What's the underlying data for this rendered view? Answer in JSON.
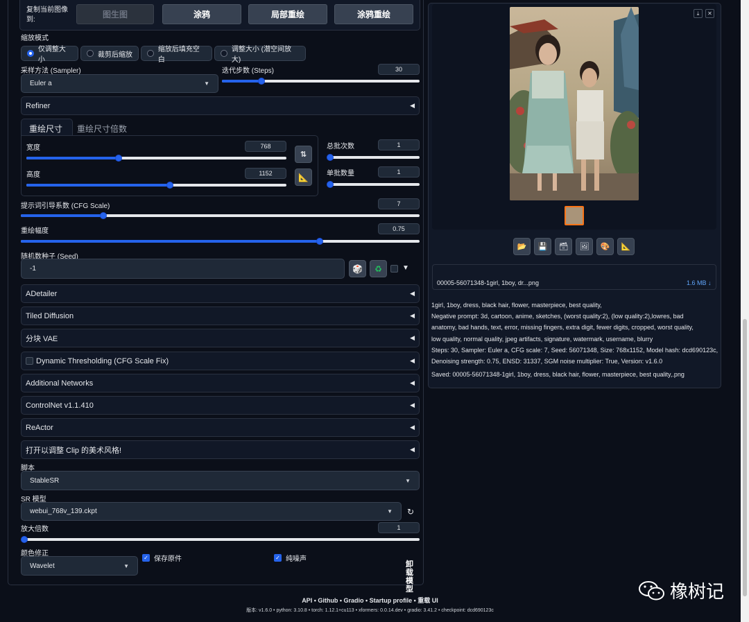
{
  "top_row": {
    "copy_label": "复制当前图像到:",
    "buttons": [
      "图生图",
      "涂鸦",
      "局部重绘",
      "涂鸦重绘"
    ]
  },
  "resize_mode": {
    "label": "缩放模式",
    "options": [
      "仅调整大小",
      "裁剪后缩放",
      "缩放后填充空白",
      "调整大小 (潜空间放大)"
    ],
    "selected": "仅调整大小"
  },
  "sampler": {
    "label": "采样方法 (Sampler)",
    "value": "Euler a"
  },
  "steps": {
    "label": "迭代步数 (Steps)",
    "value": "30",
    "fraction": 0.2
  },
  "refiner": {
    "label": "Refiner"
  },
  "size_tabs": [
    "重绘尺寸",
    "重绘尺寸倍数"
  ],
  "width": {
    "label": "宽度",
    "value": "768",
    "fraction": 0.354
  },
  "height": {
    "label": "高度",
    "value": "1152",
    "fraction": 0.552
  },
  "batch_count": {
    "label": "总批次数",
    "value": "1",
    "fraction": 0.0
  },
  "batch_size": {
    "label": "单批数量",
    "value": "1",
    "fraction": 0.0
  },
  "cfg": {
    "label": "提示词引导系数 (CFG Scale)",
    "value": "7",
    "fraction": 0.207
  },
  "denoise": {
    "label": "重绘幅度",
    "value": "0.75",
    "fraction": 0.75
  },
  "seed": {
    "label": "随机数种子 (Seed)",
    "value": "-1"
  },
  "accordions": [
    "ADetailer",
    "Tiled Diffusion",
    "分块 VAE",
    "Dynamic Thresholding (CFG Scale Fix)",
    "Additional Networks",
    "ControlNet v1.1.410",
    "ReActor",
    "打开以调整 Clip 的美术风格!"
  ],
  "script": {
    "label": "脚本",
    "value": "StableSR"
  },
  "sr_model": {
    "label": "SR 模型",
    "value": "webui_768v_139.ckpt"
  },
  "scale": {
    "label": "放大倍数",
    "value": "1",
    "fraction": 0.0
  },
  "color_fix": {
    "label": "颜色修正",
    "value": "Wavelet"
  },
  "save_original": {
    "label": "保存原件",
    "checked": true
  },
  "pure_noise": {
    "label": "纯噪声",
    "checked": true
  },
  "unload_model": "卸载模型",
  "output": {
    "filename": "00005-56071348-1girl, 1boy, dr...png",
    "filesize": "1.6 MB ↓",
    "info_lines": [
      "1girl, 1boy, dress, black hair, flower, masterpiece, best quality,",
      "Negative prompt: 3d, cartoon, anime, sketches, (worst quality:2), (low quality:2),lowres, bad",
      "anatomy, bad hands, text, error, missing fingers, extra digit, fewer digits, cropped, worst quality,",
      "low quality, normal quality, jpeg artifacts, signature, watermark, username, blurry",
      "Steps: 30, Sampler: Euler a, CFG scale: 7, Seed: 56071348, Size: 768x1152, Model hash: dcd690123c,",
      "Denoising strength: 0.75, ENSD: 31337, SGM noise multiplier: True, Version: v1.6.0"
    ],
    "saved": "Saved: 00005-56071348-1girl, 1boy, dress, black hair, flower, masterpiece, best quality,.png"
  },
  "footer": {
    "links": "API  •  Github  •  Gradio  •  Startup profile  •  重载 UI",
    "versions": "版本: v1.6.0  •  python: 3.10.8  •  torch: 1.12.1+cu113  •  xformers: 0.0.14.dev  •  gradio: 3.41.2  •  checkpoint: dcd690123c"
  },
  "watermark": "橡树记",
  "colors": {
    "accent": "#2563eb",
    "background": "#0b0f19",
    "panel": "#111827"
  }
}
